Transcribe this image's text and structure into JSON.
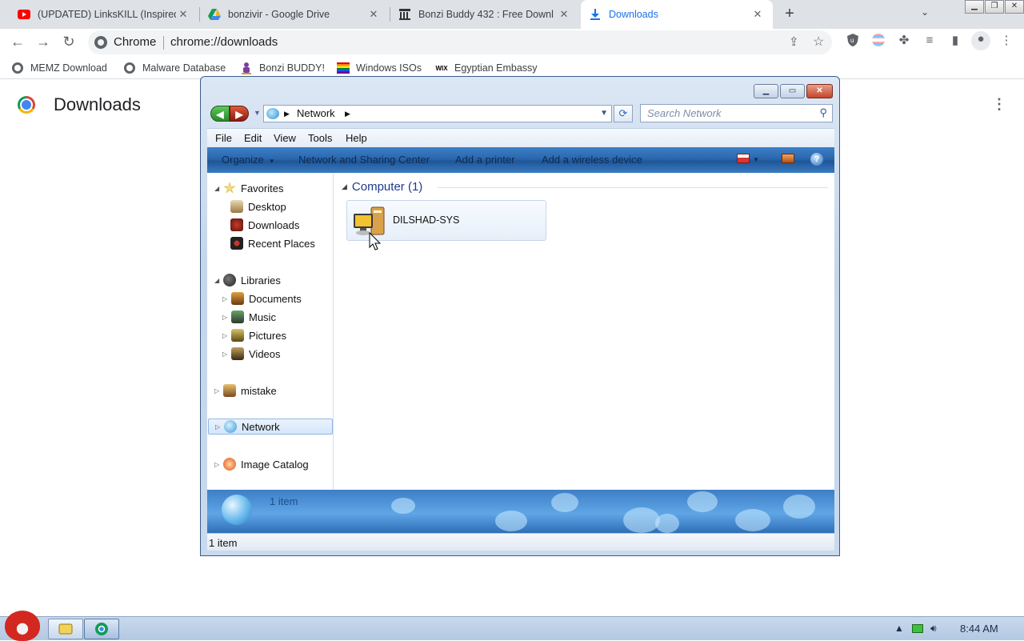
{
  "browser": {
    "tabs": [
      {
        "title": "(UPDATED) LinksKILL (Inspired",
        "icon": "youtube-icon"
      },
      {
        "title": "bonzivir - Google Drive",
        "icon": "google-drive-icon"
      },
      {
        "title": "Bonzi Buddy 432 : Free Downl",
        "icon": "internet-archive-icon"
      },
      {
        "title": "Downloads",
        "icon": "download-icon"
      }
    ],
    "omnibox": {
      "label": "Chrome",
      "url": "chrome://downloads"
    },
    "bookmarks": [
      {
        "label": "MEMZ Download",
        "icon": "globe-icon"
      },
      {
        "label": "Malware Database",
        "icon": "globe-icon"
      },
      {
        "label": "Bonzi BUDDY!",
        "icon": "bonzi-icon"
      },
      {
        "label": "Windows ISOs",
        "icon": "rainbow-flag-icon"
      },
      {
        "label": "Egyptian Embassy",
        "icon": "wix-icon"
      }
    ],
    "wix_text": "WIX",
    "page_title": "Downloads"
  },
  "explorer": {
    "address": [
      "Network"
    ],
    "search_placeholder": "Search Network",
    "menu": [
      "File",
      "Edit",
      "View",
      "Tools",
      "Help"
    ],
    "commands": [
      "Organize",
      "Network and Sharing Center",
      "Add a printer",
      "Add a wireless device"
    ],
    "help_glyph": "?",
    "nav": {
      "favorites": {
        "label": "Favorites",
        "items": [
          "Desktop",
          "Downloads",
          "Recent Places"
        ]
      },
      "libraries": {
        "label": "Libraries",
        "items": [
          "Documents",
          "Music",
          "Pictures",
          "Videos"
        ]
      },
      "mistake": "mistake",
      "network": "Network",
      "image_catalog": "Image Catalog"
    },
    "group_header": "Computer (1)",
    "computer": {
      "name": "DILSHAD-SYS"
    },
    "details_text": "1 item",
    "status_text": "1 item"
  },
  "taskbar": {
    "clock": "8:44 AM"
  },
  "colors": {
    "accent": "#1a73e8",
    "command_bar": "#2a67ad",
    "group_header": "#1e3a8c"
  }
}
